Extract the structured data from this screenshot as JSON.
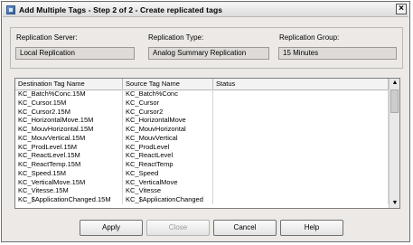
{
  "window": {
    "title": "Add Multiple Tags - Step 2 of 2 - Create replicated tags"
  },
  "fields": {
    "server": {
      "label": "Replication Server:",
      "value": "Local Replication"
    },
    "type": {
      "label": "Replication Type:",
      "value": "Analog Summary Replication"
    },
    "group": {
      "label": "Replication Group:",
      "value": "15 Minutes"
    }
  },
  "table": {
    "headers": [
      "Destination Tag Name",
      "Source Tag Name",
      "Status"
    ],
    "rows": [
      [
        "KC_Batch%Conc.15M",
        "KC_Batch%Conc",
        ""
      ],
      [
        "KC_Cursor.15M",
        "KC_Cursor",
        ""
      ],
      [
        "KC_Cursor2.15M",
        "KC_Cursor2",
        ""
      ],
      [
        "KC_HorizontalMove.15M",
        "KC_HorizontalMove",
        ""
      ],
      [
        "KC_MouvHorizontal.15M",
        "KC_MouvHorizontal",
        ""
      ],
      [
        "KC_MouvVertical.15M",
        "KC_MouvVertical",
        ""
      ],
      [
        "KC_ProdLevel.15M",
        "KC_ProdLevel",
        ""
      ],
      [
        "KC_ReactLevel.15M",
        "KC_ReactLevel",
        ""
      ],
      [
        "KC_ReactTemp.15M",
        "KC_ReactTemp",
        ""
      ],
      [
        "KC_Speed.15M",
        "KC_Speed",
        ""
      ],
      [
        "KC_VerticalMove.15M",
        "KC_VerticalMove",
        ""
      ],
      [
        "KC_Vitesse.15M",
        "KC_Vitesse",
        ""
      ],
      [
        "KC_$ApplicationChanged.15M",
        "KC_$ApplicationChanged",
        ""
      ]
    ]
  },
  "buttons": {
    "apply": "Apply",
    "close": "Close",
    "cancel": "Cancel",
    "help": "Help"
  }
}
